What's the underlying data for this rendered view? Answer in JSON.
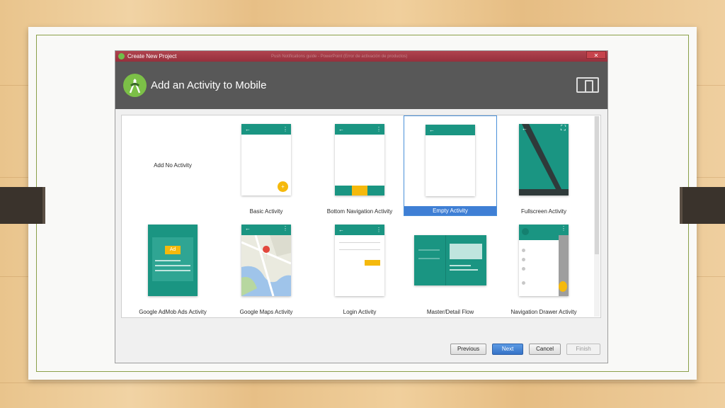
{
  "window": {
    "title": "Create New Project",
    "background_caption": "Push Notifications guide - PowerPoint (Error de activación de productos)",
    "close_glyph": "✕"
  },
  "header": {
    "title": "Add an Activity to Mobile"
  },
  "activities": [
    {
      "label": "Add No Activity",
      "selected": false
    },
    {
      "label": "Basic Activity",
      "selected": false
    },
    {
      "label": "Bottom Navigation Activity",
      "selected": false
    },
    {
      "label": "Empty Activity",
      "selected": true
    },
    {
      "label": "Fullscreen Activity",
      "selected": false
    },
    {
      "label": "Google AdMob Ads Activity",
      "selected": false
    },
    {
      "label": "Google Maps Activity",
      "selected": false
    },
    {
      "label": "Login Activity",
      "selected": false
    },
    {
      "label": "Master/Detail Flow",
      "selected": false
    },
    {
      "label": "Navigation Drawer Activity",
      "selected": false
    }
  ],
  "preview": {
    "back_arrow": "←",
    "overflow_dots": "⋮",
    "fab_plus": "+",
    "fullscreen_glyph": "⛶",
    "ad_label": "Ad"
  },
  "buttons": {
    "previous": "Previous",
    "next": "Next",
    "cancel": "Cancel",
    "finish": "Finish"
  },
  "colors": {
    "accent_teal": "#1a9582",
    "fab_yellow": "#f5b90c",
    "selection_blue": "#3f7fd5",
    "header_gray": "#585858"
  }
}
